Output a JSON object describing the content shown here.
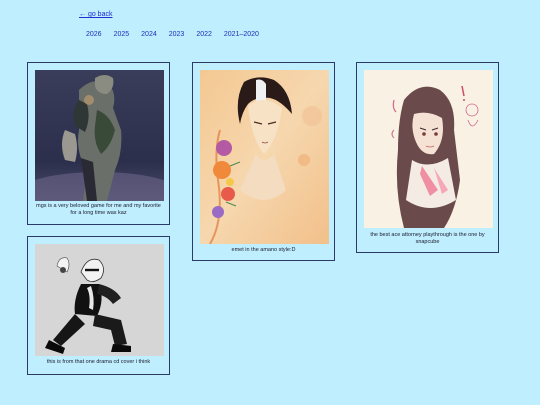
{
  "nav": {
    "go_back": "← go back"
  },
  "years": [
    "2026",
    "2025",
    "2024",
    "2023",
    "2022",
    "2021–2020"
  ],
  "cards": [
    {
      "caption": "mgs is a very beloved game for me and my favorite for a long time was kaz"
    },
    {
      "caption": "emet in the amano style:D"
    },
    {
      "caption": "the best ace attorney playthrough is the one by snapcube"
    },
    {
      "caption": "this is from that one drama cd cover i think"
    }
  ]
}
